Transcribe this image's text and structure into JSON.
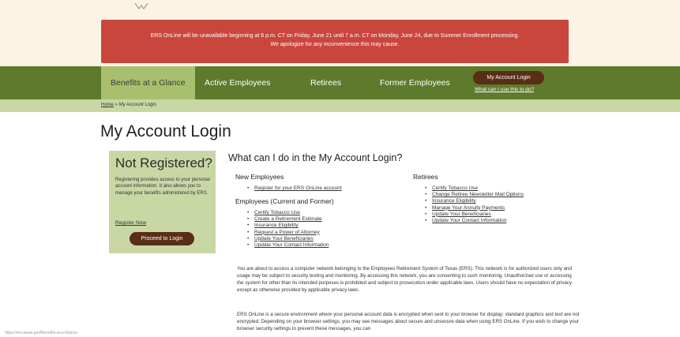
{
  "alert": {
    "line1": "ERS OnLine will be unavailable beginning at 6 p.m. CT on Friday, June 21 until 7 a.m. CT on Monday, June 24, due to Summer Enrollment processing.",
    "line2": "We apologize for any inconvenience this may cause."
  },
  "nav": {
    "items": [
      {
        "label": "Benefits at a Glance"
      },
      {
        "label": "Active Employees"
      },
      {
        "label": "Retirees"
      },
      {
        "label": "Former Employees"
      }
    ],
    "account_button": "My Account Login",
    "account_link": "What can I use this to do?"
  },
  "breadcrumb": {
    "home": "Home",
    "sep": " » ",
    "current": "My Account Login"
  },
  "page_title": "My Account Login",
  "card": {
    "title": "Not Registered?",
    "text": "Registering provides access to your personal account information. It also allows you to manage your benefits administered by ERS.",
    "register_link": "Register Now",
    "login_button": "Proceed to Login"
  },
  "main": {
    "heading": "What can I do in the My Account Login?",
    "new_employees": {
      "title": "New Employees",
      "items": [
        "Register for your ERS OnLine account"
      ]
    },
    "employees": {
      "title": "Employees (Current and Former)",
      "items": [
        "Certify Tobacco Use",
        "Create a Retirement Estimate",
        "Insurance Eligibility",
        "Request a Power of Attorney",
        "Update Your Beneficiaries",
        "Update Your Contact Information"
      ]
    },
    "retirees": {
      "title": "Retirees",
      "items": [
        "Certify Tobacco Use",
        "Change Retiree Newsletter Mail Options",
        "Insurance Eligibility",
        "Manage Your Annuity Payments",
        "Update Your Beneficiaries",
        "Update Your Contact Information"
      ]
    },
    "para1": "You are about to access a computer network belonging to the Employees Retirement System of Texas (ERS). This network is for authorized users only and usage may be subject to security testing and monitoring. By accessing this network, you are consenting to such monitoring. Unauthorized use or accessing the system for other than its intended purposes is prohibited and subject to prosecution under applicable laws. Users should have no expectation of privacy except as otherwise provided by applicable privacy laws.",
    "para2": "ERS OnLine is a secure environment where your personal account data is encrypted when sent to your browser for display; standard graphics and text are not encrypted. Depending on your browser settings, you may see messages about secure and unsecure data when using ERS OnLine. If you wish to change your browser security settings to prevent these messages, you can"
  },
  "bullet": "•",
  "status_url": "https://ers.texas.gov/Benefits-at-a-Glance",
  "colors": {
    "nav": "#5d7a2d",
    "nav_active": "#a8bf6d",
    "alert": "#c9463d",
    "button": "#5a2d16",
    "card": "#c9d7a5"
  }
}
